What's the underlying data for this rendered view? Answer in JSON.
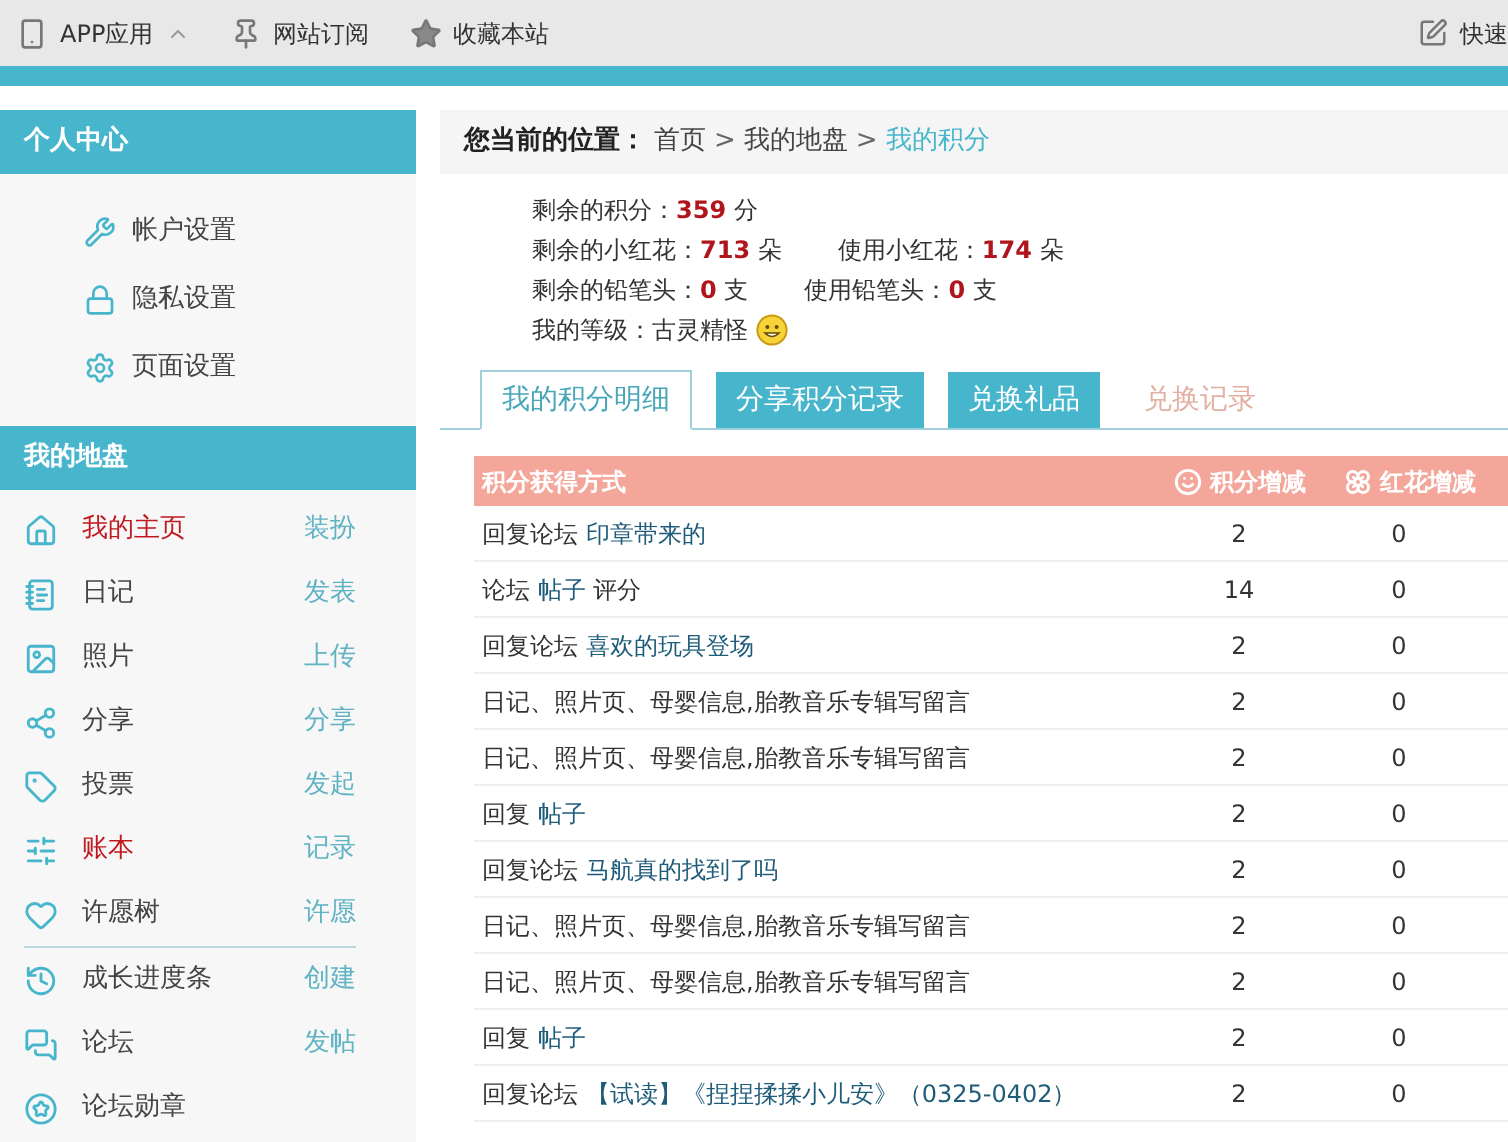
{
  "top_bar": {
    "items": [
      {
        "label": "APP应用"
      },
      {
        "label": "网站订阅"
      },
      {
        "label": "收藏本站"
      }
    ],
    "right": "快速"
  },
  "sidebar": {
    "sections": [
      {
        "title": "个人中心",
        "items": [
          {
            "label": "帐户设置"
          },
          {
            "label": "隐私设置"
          },
          {
            "label": "页面设置"
          }
        ]
      },
      {
        "title": "我的地盘",
        "groups": [
          [
            {
              "label": "我的主页",
              "action": "装扮",
              "highlighted": true
            },
            {
              "label": "日记",
              "action": "发表",
              "highlighted": false
            },
            {
              "label": "照片",
              "action": "上传",
              "highlighted": false
            },
            {
              "label": "分享",
              "action": "分享",
              "highlighted": false
            },
            {
              "label": "投票",
              "action": "发起",
              "highlighted": false
            },
            {
              "label": "账本",
              "action": "记录",
              "highlighted": true
            },
            {
              "label": "许愿树",
              "action": "许愿",
              "highlighted": false
            }
          ],
          [
            {
              "label": "成长进度条",
              "action": "创建",
              "highlighted": false
            },
            {
              "label": "论坛",
              "action": "发帖",
              "highlighted": false
            },
            {
              "label": "论坛勋章",
              "highlighted": false
            }
          ]
        ]
      }
    ]
  },
  "breadcrumb": {
    "label": "您当前的位置：",
    "items": [
      {
        "text": "首页",
        "current": false
      },
      {
        "text": "我的地盘",
        "current": false
      },
      {
        "text": "我的积分",
        "current": true
      }
    ],
    "separator": ">"
  },
  "stats": [
    [
      {
        "label": "剩余的积分：",
        "value": "359",
        "unit": "分"
      }
    ],
    [
      {
        "label": "剩余的小红花：",
        "value": "713",
        "unit": "朵"
      },
      {
        "label": "使用小红花：",
        "value": "174",
        "unit": "朵"
      }
    ],
    [
      {
        "label": "剩余的铅笔头：",
        "value": "0",
        "unit": "支"
      },
      {
        "label": "使用铅笔头：",
        "value": "0",
        "unit": "支"
      }
    ]
  ],
  "level": {
    "label": "我的等级：",
    "value": "古灵精怪"
  },
  "tabs": [
    {
      "label": "我的积分明细",
      "selected": true,
      "kind": "filled"
    },
    {
      "label": "分享积分记录",
      "selected": false,
      "kind": "filled"
    },
    {
      "label": "兑换礼品",
      "selected": false,
      "kind": "filled"
    },
    {
      "label": "兑换记录",
      "selected": false,
      "kind": "plain"
    }
  ],
  "table": {
    "columns": [
      "积分获得方式",
      "积分增减",
      "红花增减"
    ],
    "rows": [
      {
        "prefix": "回复论坛",
        "link": "印章带来的",
        "points": "2",
        "flowers": "0"
      },
      {
        "prefix": "论坛",
        "link": "帖子",
        "suffix": "评分",
        "points": "14",
        "flowers": "0"
      },
      {
        "prefix": "回复论坛",
        "link": "喜欢的玩具登场",
        "points": "2",
        "flowers": "0"
      },
      {
        "prefix": "日记、照片页、母婴信息,胎教音乐专辑写留言",
        "points": "2",
        "flowers": "0"
      },
      {
        "prefix": "日记、照片页、母婴信息,胎教音乐专辑写留言",
        "points": "2",
        "flowers": "0"
      },
      {
        "prefix": "回复",
        "link": "帖子",
        "points": "2",
        "flowers": "0"
      },
      {
        "prefix": "回复论坛",
        "link": "马航真的找到了吗",
        "points": "2",
        "flowers": "0"
      },
      {
        "prefix": "日记、照片页、母婴信息,胎教音乐专辑写留言",
        "points": "2",
        "flowers": "0"
      },
      {
        "prefix": "日记、照片页、母婴信息,胎教音乐专辑写留言",
        "points": "2",
        "flowers": "0"
      },
      {
        "prefix": "回复",
        "link": "帖子",
        "points": "2",
        "flowers": "0"
      },
      {
        "prefix": "回复论坛",
        "link": "【试读】《捏捏揉揉小儿安》（0325-0402）",
        "points": "2",
        "flowers": "0"
      }
    ]
  }
}
